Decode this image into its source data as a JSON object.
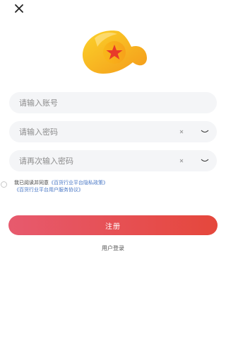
{
  "icons": {
    "close": "close-icon",
    "logo": "app-logo-icon",
    "clear": "clear-icon",
    "eye": "eye-closed-icon"
  },
  "colors": {
    "accent_start": "#e75a6e",
    "accent_end": "#e5473c",
    "link": "#4a78c6",
    "logo_yellow": "#f8c21a",
    "logo_orange": "#f49a1a",
    "logo_star": "#e83a2a"
  },
  "form": {
    "account_placeholder": "请输入账号",
    "password_placeholder": "请输入密码",
    "confirm_placeholder": "请再次输入密码",
    "clear_glyph": "×"
  },
  "agreement": {
    "prefix": "我已阅读并同意",
    "privacy_link": "《百货行业平台隐私政策》",
    "service_link": "《百货行业平台用户服务协议》"
  },
  "actions": {
    "register_label": "注册",
    "login_label": "用户登录"
  }
}
